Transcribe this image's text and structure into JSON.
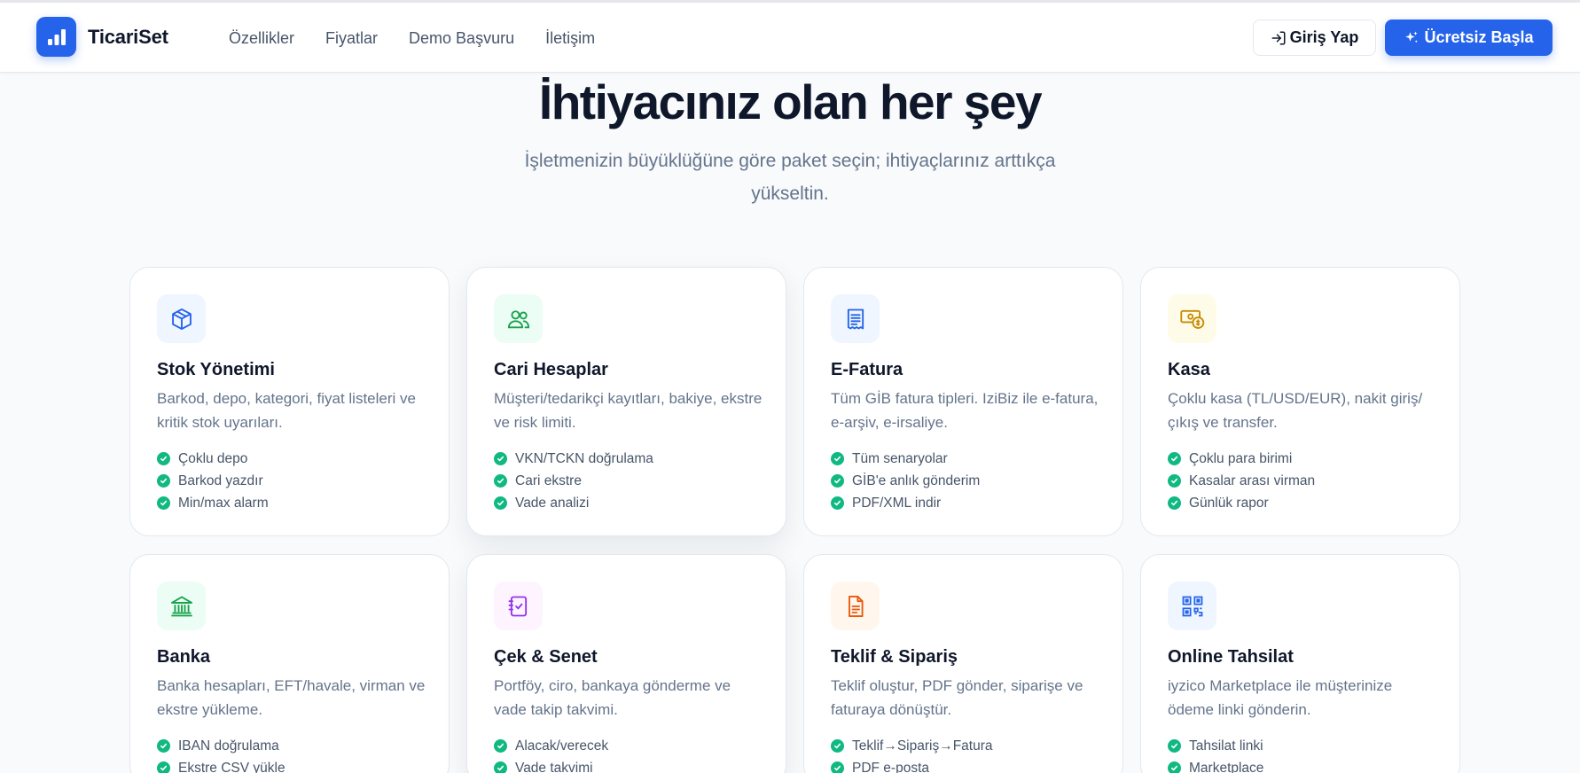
{
  "header": {
    "brand": "TicariSet",
    "nav": [
      "Özellikler",
      "Fiyatlar",
      "Demo Başvuru",
      "İletişim"
    ],
    "login_label": "Giriş Yap",
    "start_label": "Ücretsiz Başla"
  },
  "hero": {
    "title": "İhtiyacınız olan her şey",
    "subtitle": "İşletmenizin büyüklüğüne göre paket seçin; ihtiyaçlarınız arttıkça yükseltin."
  },
  "colors": {
    "primary": "#2563eb",
    "check": "#10b981",
    "text_dark": "#0f172a",
    "text_muted": "#64748b"
  },
  "cards": [
    {
      "title": "Stok Yönetimi",
      "desc": "Barkod, depo, kategori, fiyat listeleri ve kritik stok uyarıları.",
      "icon": "box-icon",
      "features": [
        "Çoklu depo",
        "Barkod yazdır",
        "Min/max alarm"
      ]
    },
    {
      "title": "Cari Hesaplar",
      "desc": "Müşteri/tedarikçi kayıtları, bakiye, ekstre ve risk limiti.",
      "icon": "users-icon",
      "features": [
        "VKN/TCKN doğrulama",
        "Cari ekstre",
        "Vade analizi"
      ]
    },
    {
      "title": "E-Fatura",
      "desc": "Tüm GİB fatura tipleri. IziBiz ile e-fatura, e-arşiv, e-irsaliye.",
      "icon": "receipt-icon",
      "features": [
        "Tüm senaryolar",
        "GİB'e anlık gönderim",
        "PDF/XML indir"
      ]
    },
    {
      "title": "Kasa",
      "desc": "Çoklu kasa (TL/USD/EUR), nakit giriş/çıkış ve transfer.",
      "icon": "cash-icon",
      "features": [
        "Çoklu para birimi",
        "Kasalar arası virman",
        "Günlük rapor"
      ]
    },
    {
      "title": "Banka",
      "desc": "Banka hesapları, EFT/havale, virman ve ekstre yükleme.",
      "icon": "bank-icon",
      "features": [
        "IBAN doğrulama",
        "Ekstre CSV yükle"
      ]
    },
    {
      "title": "Çek & Senet",
      "desc": "Portföy, ciro, bankaya gönderme ve vade takip takvimi.",
      "icon": "notebook-check-icon",
      "features": [
        "Alacak/verecek",
        "Vade takvimi"
      ]
    },
    {
      "title": "Teklif & Sipariş",
      "desc": "Teklif oluştur, PDF gönder, siparişe ve faturaya dönüştür.",
      "icon": "document-icon",
      "features": [
        "Teklif→Sipariş→Fatura",
        "PDF e-posta"
      ]
    },
    {
      "title": "Online Tahsilat",
      "desc": "iyzico Marketplace ile müşterinize ödeme linki gönderin.",
      "icon": "qr-code-icon",
      "features": [
        "Tahsilat linki",
        "Marketplace"
      ]
    }
  ]
}
